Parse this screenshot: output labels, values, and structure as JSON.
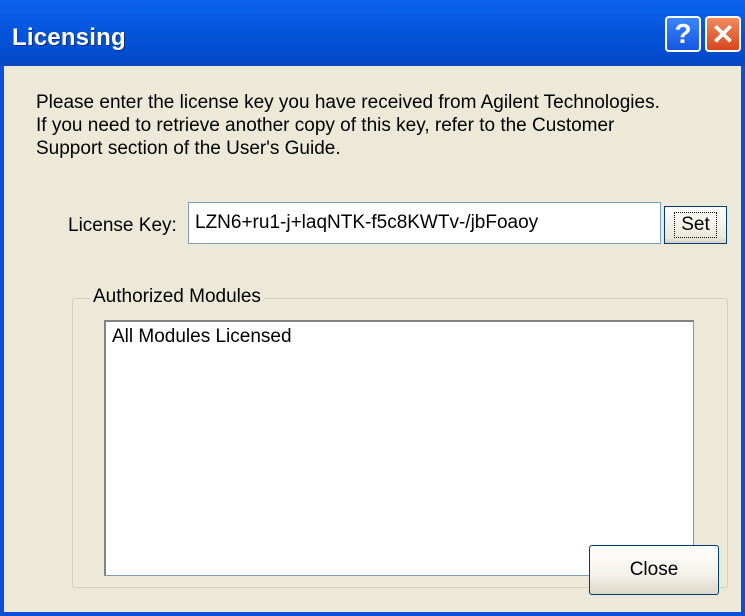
{
  "window": {
    "title": "Licensing"
  },
  "titlebar_buttons": {
    "help": "?",
    "close": "✕"
  },
  "intro": [
    "Please enter the license key you have received from Agilent Technologies.",
    "If you need to retrieve another copy of this key, refer to the Customer",
    "Support section of the User's Guide."
  ],
  "license": {
    "label": "License Key:",
    "value": "LZN6+ru1-j+laqNTK-f5c8KWTv-/jbFoaoy",
    "set_label": "Set"
  },
  "modules": {
    "group_label": "Authorized Modules",
    "items": [
      "All Modules Licensed"
    ]
  },
  "footer": {
    "close_label": "Close"
  },
  "colors": {
    "titlebar": "#0553d8",
    "client": "#ece9d8",
    "close_button": "#d8461c"
  }
}
